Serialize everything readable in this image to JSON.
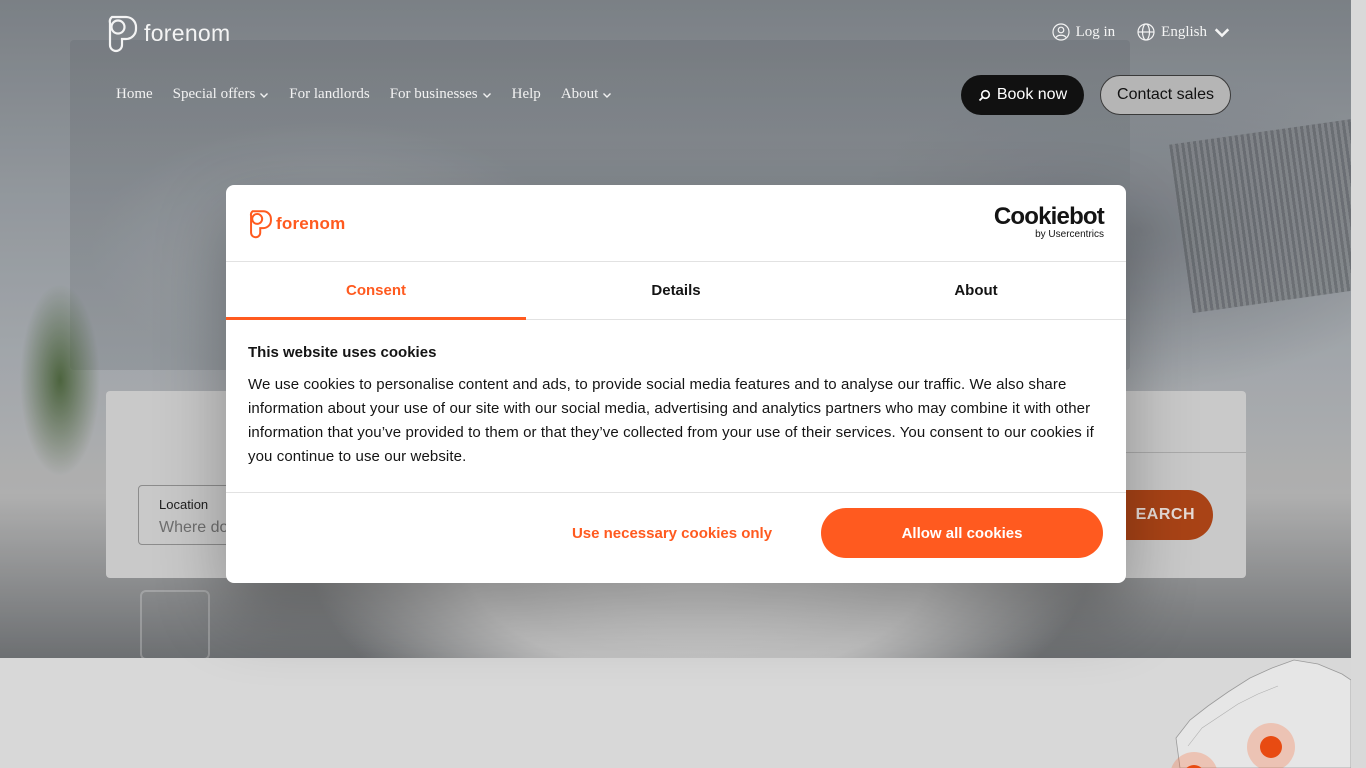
{
  "brand": {
    "name": "forenom",
    "accent": "#ff5a1f"
  },
  "header": {
    "login_label": "Log in",
    "language_label": "English",
    "nav": [
      {
        "label": "Home",
        "has_dropdown": false
      },
      {
        "label": "Special offers",
        "has_dropdown": true
      },
      {
        "label": "For landlords",
        "has_dropdown": false
      },
      {
        "label": "For businesses",
        "has_dropdown": true
      },
      {
        "label": "Help",
        "has_dropdown": false
      },
      {
        "label": "About",
        "has_dropdown": true
      }
    ],
    "book_now_label": "Book now",
    "contact_sales_label": "Contact sales"
  },
  "search": {
    "location_label": "Location",
    "location_placeholder": "Where do",
    "search_button_label": "EARCH"
  },
  "cookie_dialog": {
    "brand_logo": "forenom",
    "provider_name": "Cookiebot",
    "provider_sub": "by Usercentrics",
    "tabs": [
      {
        "label": "Consent",
        "active": true
      },
      {
        "label": "Details",
        "active": false
      },
      {
        "label": "About",
        "active": false
      }
    ],
    "title": "This website uses cookies",
    "body": "We use cookies to personalise content and ads, to provide social media features and to analyse our traffic. We also share information about your use of our site with our social media, advertising and analytics partners who may combine it with other information that you’ve provided to them or that they’ve collected from your use of their services. You consent to our cookies if you continue to use our website.",
    "necessary_button_label": "Use necessary cookies only",
    "allow_all_button_label": "Allow all cookies"
  }
}
